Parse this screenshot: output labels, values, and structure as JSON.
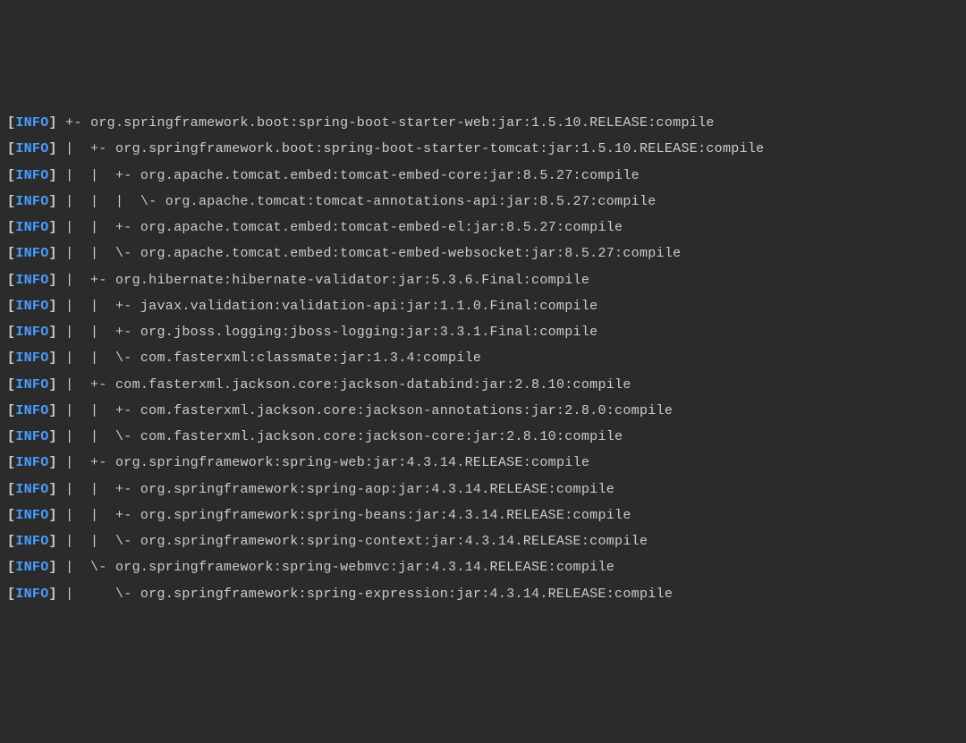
{
  "log_level": "INFO",
  "bracket_open": "[",
  "bracket_close": "]",
  "lines": [
    {
      "tree": " +- ",
      "dep": "org.springframework.boot:spring-boot-starter-web:jar:1.5.10.RELEASE:compile"
    },
    {
      "tree": " |  +- ",
      "dep": "org.springframework.boot:spring-boot-starter-tomcat:jar:1.5.10.RELEASE:compile"
    },
    {
      "tree": " |  |  +- ",
      "dep": "org.apache.tomcat.embed:tomcat-embed-core:jar:8.5.27:compile"
    },
    {
      "tree": " |  |  |  \\- ",
      "dep": "org.apache.tomcat:tomcat-annotations-api:jar:8.5.27:compile"
    },
    {
      "tree": " |  |  +- ",
      "dep": "org.apache.tomcat.embed:tomcat-embed-el:jar:8.5.27:compile"
    },
    {
      "tree": " |  |  \\- ",
      "dep": "org.apache.tomcat.embed:tomcat-embed-websocket:jar:8.5.27:compile"
    },
    {
      "tree": " |  +- ",
      "dep": "org.hibernate:hibernate-validator:jar:5.3.6.Final:compile"
    },
    {
      "tree": " |  |  +- ",
      "dep": "javax.validation:validation-api:jar:1.1.0.Final:compile"
    },
    {
      "tree": " |  |  +- ",
      "dep": "org.jboss.logging:jboss-logging:jar:3.3.1.Final:compile"
    },
    {
      "tree": " |  |  \\- ",
      "dep": "com.fasterxml:classmate:jar:1.3.4:compile"
    },
    {
      "tree": " |  +- ",
      "dep": "com.fasterxml.jackson.core:jackson-databind:jar:2.8.10:compile"
    },
    {
      "tree": " |  |  +- ",
      "dep": "com.fasterxml.jackson.core:jackson-annotations:jar:2.8.0:compile"
    },
    {
      "tree": " |  |  \\- ",
      "dep": "com.fasterxml.jackson.core:jackson-core:jar:2.8.10:compile"
    },
    {
      "tree": " |  +- ",
      "dep": "org.springframework:spring-web:jar:4.3.14.RELEASE:compile"
    },
    {
      "tree": " |  |  +- ",
      "dep": "org.springframework:spring-aop:jar:4.3.14.RELEASE:compile"
    },
    {
      "tree": " |  |  +- ",
      "dep": "org.springframework:spring-beans:jar:4.3.14.RELEASE:compile"
    },
    {
      "tree": " |  |  \\- ",
      "dep": "org.springframework:spring-context:jar:4.3.14.RELEASE:compile"
    },
    {
      "tree": " |  \\- ",
      "dep": "org.springframework:spring-webmvc:jar:4.3.14.RELEASE:compile"
    },
    {
      "tree": " |     \\- ",
      "dep": "org.springframework:spring-expression:jar:4.3.14.RELEASE:compile"
    }
  ]
}
